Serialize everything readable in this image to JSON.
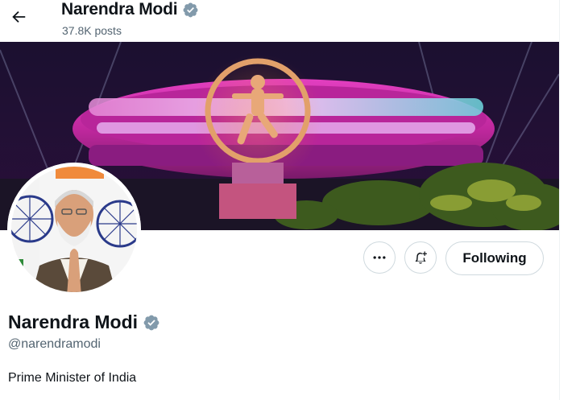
{
  "header": {
    "back_icon": "arrow-left-icon",
    "name": "Narendra Modi",
    "posts_count": "37.8K posts"
  },
  "banner": {
    "description_icon": "banner-image"
  },
  "actions": {
    "more_icon": "ellipsis-icon",
    "notify_icon": "bell-plus-icon",
    "following_label": "Following"
  },
  "profile": {
    "name": "Narendra Modi",
    "handle": "@narendramodi",
    "bio": "Prime Minister of India"
  },
  "colors": {
    "text": "#0f1419",
    "secondary_text": "#536471",
    "border": "#cfd9de",
    "verified_badge": "#829aab"
  }
}
